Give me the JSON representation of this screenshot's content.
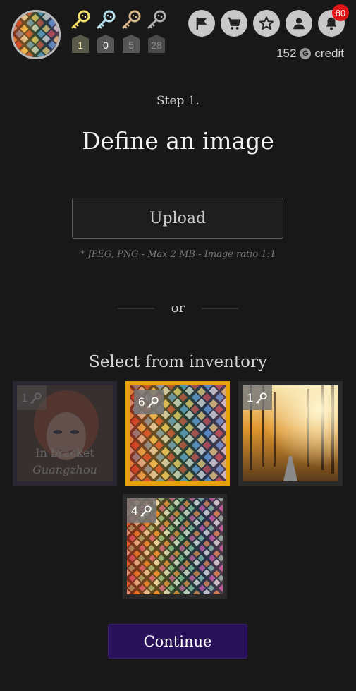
{
  "header": {
    "avatar_alt": "profile avatar",
    "keys": [
      {
        "count": "1",
        "color": "#f2e06a"
      },
      {
        "count": "0",
        "color": "#b8e3f0"
      },
      {
        "count": "5",
        "color": "#d8b88e"
      },
      {
        "count": "28",
        "color": "#b0b0b0"
      }
    ],
    "notification_count": "80",
    "credit_amount": "152",
    "credit_icon": "G",
    "credit_label": "credit"
  },
  "main": {
    "step_label": "Step 1.",
    "title": "Define an image",
    "upload_label": "Upload",
    "upload_hint": "* JPEG, PNG - Max 2 MB - Image ratio 1:1",
    "or_label": "or",
    "inventory_title": "Select from inventory",
    "tiles": [
      {
        "count": "1",
        "status": "In bracket",
        "location": "Guangzhou",
        "state": "disabled"
      },
      {
        "count": "6",
        "state": "selected"
      },
      {
        "count": "1",
        "state": "normal"
      },
      {
        "count": "4",
        "state": "normal"
      }
    ],
    "continue_label": "Continue"
  },
  "colors": {
    "accent_selected": "#e6a00e",
    "continue_bg": "#29125a",
    "badge_red": "#e01414"
  }
}
